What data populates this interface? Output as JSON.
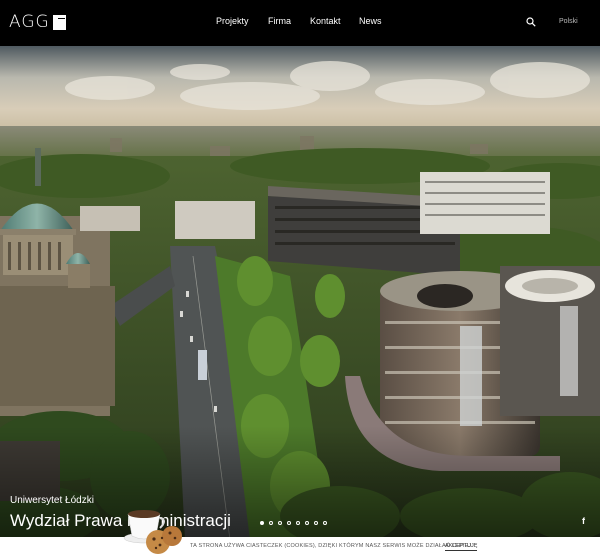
{
  "header": {
    "logo_text": "AGG",
    "nav": [
      {
        "label": "Projekty"
      },
      {
        "label": "Firma"
      },
      {
        "label": "Kontakt"
      },
      {
        "label": "News"
      }
    ],
    "search_icon": "search-icon",
    "language": "Polski"
  },
  "hero": {
    "subtitle": "Uniwersytet Łódzki",
    "title": "Wydział Prawa i Administracji",
    "slides_total": 8,
    "slide_active": 1,
    "social_icon": "facebook-icon",
    "social_label": "f"
  },
  "cookie_bar": {
    "text": "TA STRONA UŻYWA CIASTECZEK (COOKIES), DZIĘKI KTÓRYM NASZ SERWIS MOŻE DZIAŁAĆ LEPIEJ.",
    "accept_label": "AKCEPTUJĘ",
    "icon": "cookie-cup-icon"
  },
  "colors": {
    "header_bg": "#000000",
    "cookie_bg": "#ffffff"
  }
}
